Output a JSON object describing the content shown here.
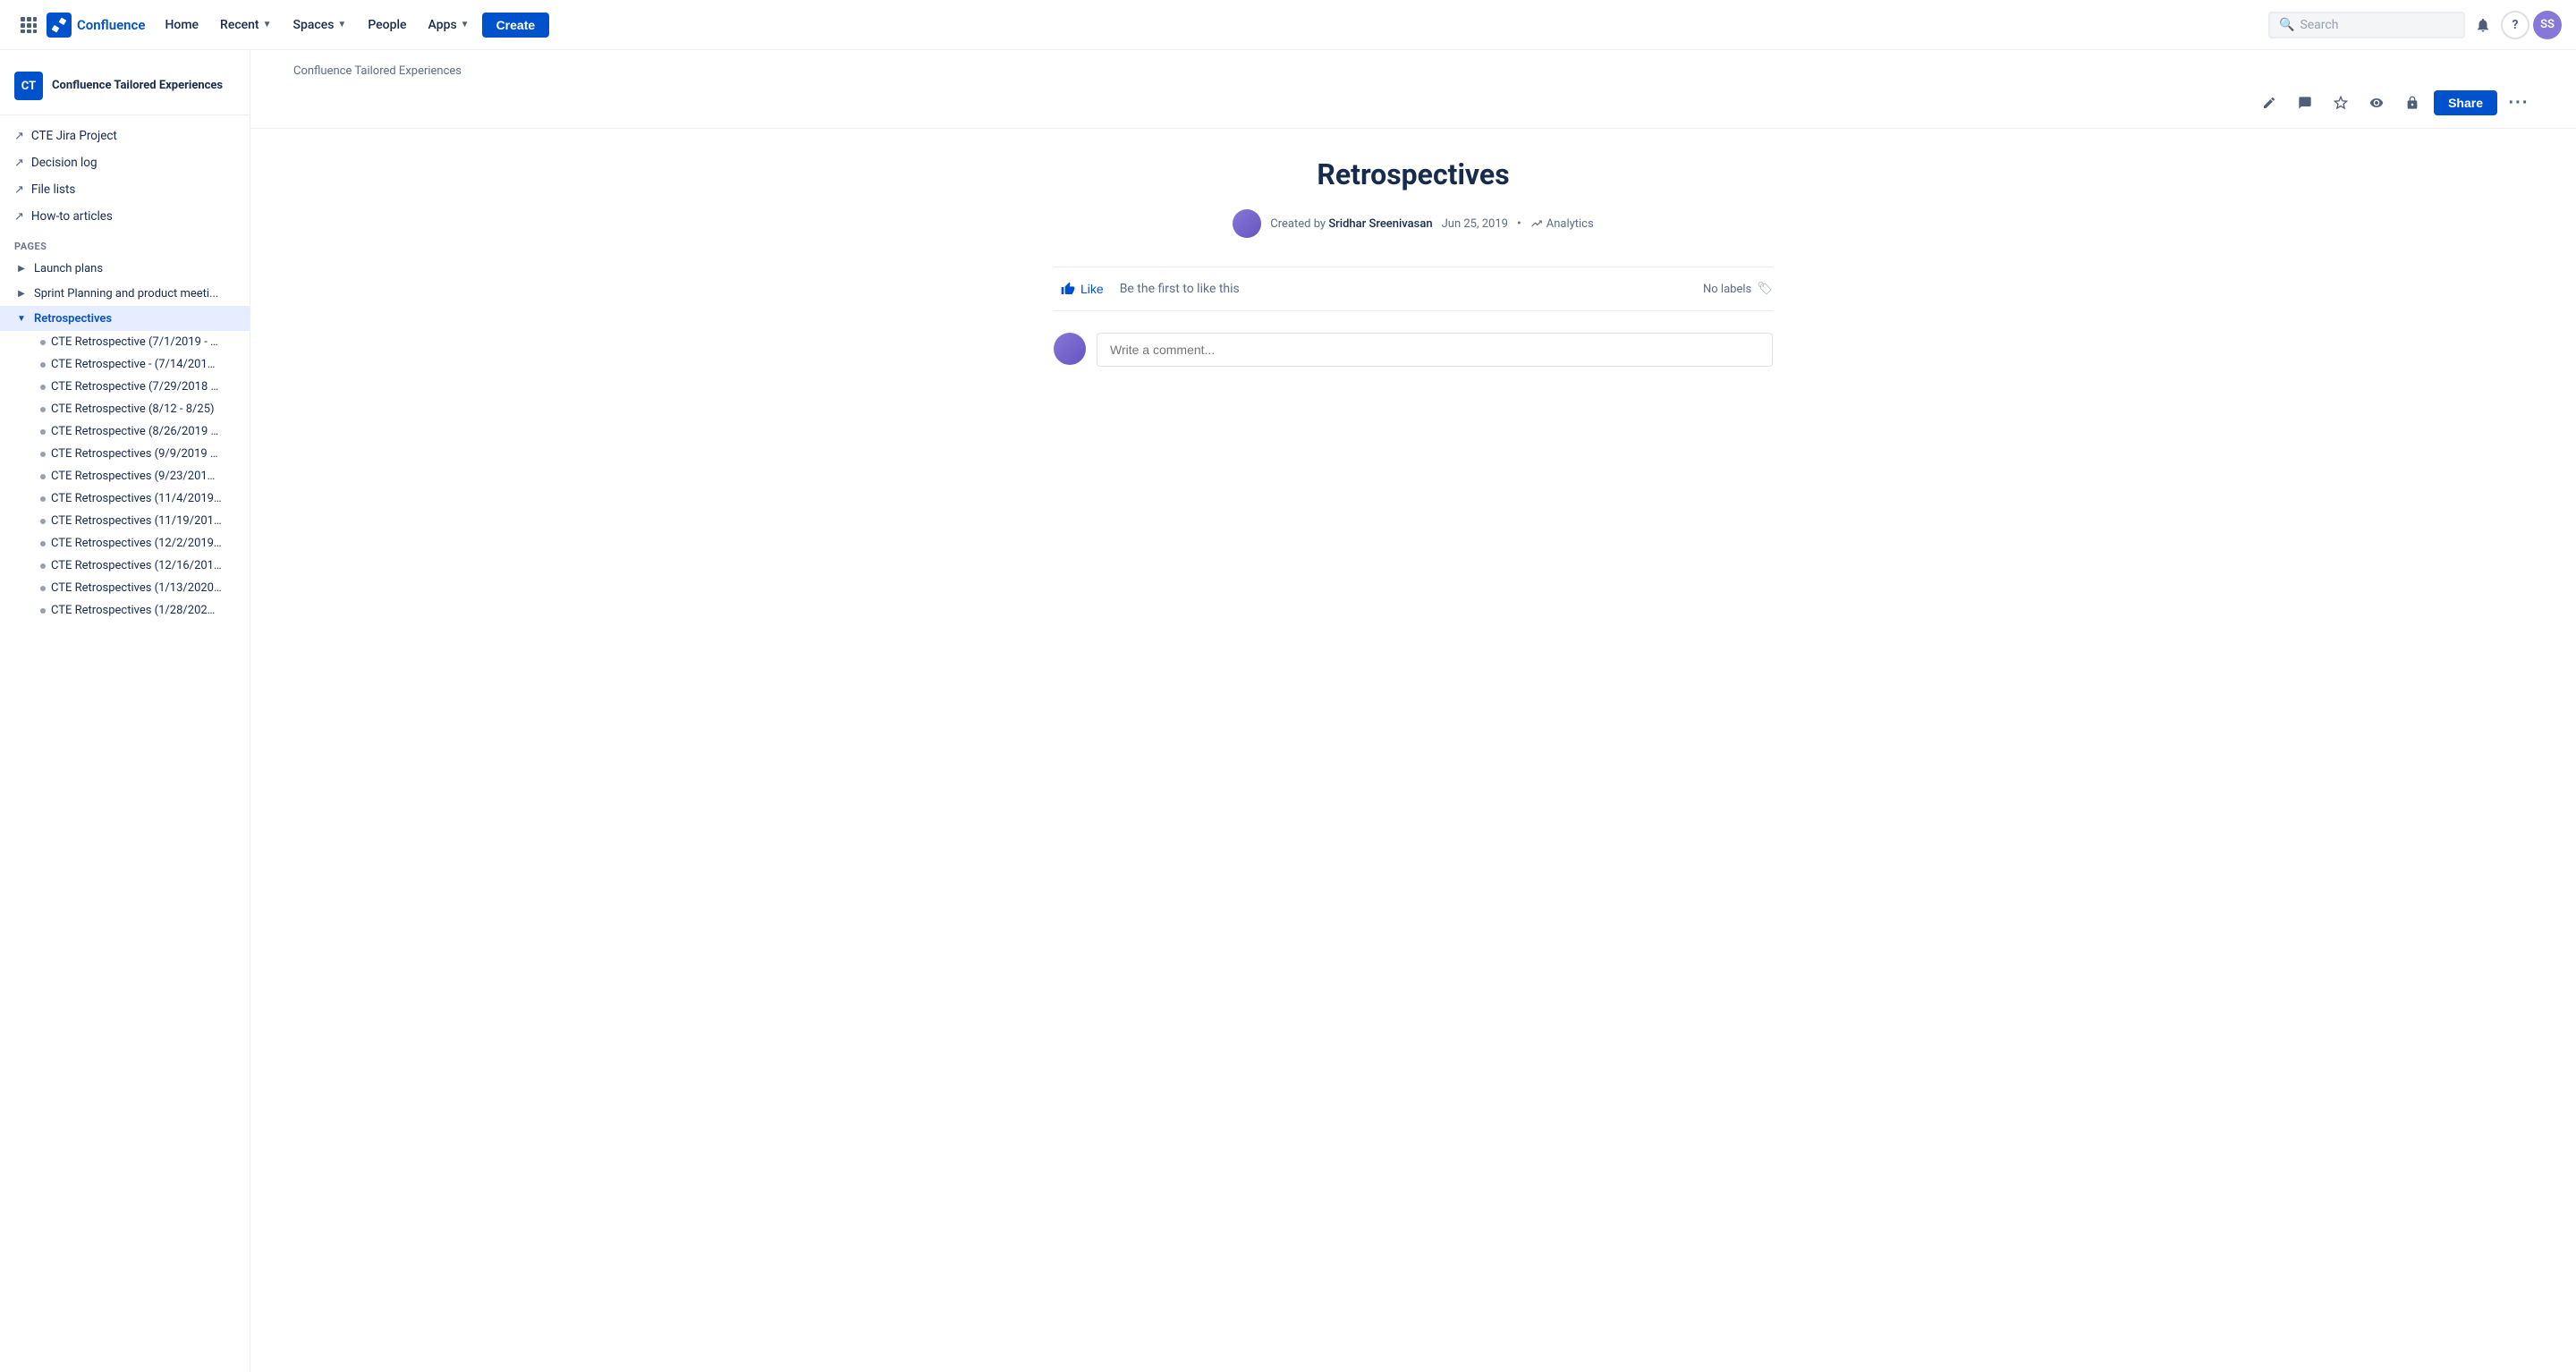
{
  "nav": {
    "logo_text": "Confluence",
    "home_label": "Home",
    "recent_label": "Recent",
    "spaces_label": "Spaces",
    "people_label": "People",
    "apps_label": "Apps",
    "create_label": "Create",
    "search_placeholder": "Search",
    "grid_icon": "⊞",
    "bell_icon": "🔔",
    "help_icon": "?",
    "avatar_initials": "SS"
  },
  "sidebar": {
    "space_name": "Confluence Tailored Experiences",
    "space_initials": "CT",
    "nav_items": [
      {
        "label": "CTE Jira Project",
        "icon": "↗"
      },
      {
        "label": "Decision log",
        "icon": "↗"
      },
      {
        "label": "File lists",
        "icon": "↗"
      },
      {
        "label": "How-to articles",
        "icon": "↗"
      }
    ],
    "pages_section_label": "PAGES",
    "tree_items": [
      {
        "label": "Launch plans",
        "expanded": false,
        "active": false,
        "indent": 0
      },
      {
        "label": "Sprint Planning and product meeti...",
        "expanded": false,
        "active": false,
        "indent": 0
      },
      {
        "label": "Retrospectives",
        "expanded": true,
        "active": true,
        "indent": 0
      }
    ],
    "child_items": [
      "CTE Retrospective (7/1/2019 - …",
      "CTE Retrospective - (7/14/201…",
      "CTE Retrospective (7/29/2018 …",
      "CTE Retrospective (8/12 - 8/25)",
      "CTE Retrospective (8/26/2019 …",
      "CTE Retrospectives (9/9/2019 …",
      "CTE Retrospectives (9/23/201…",
      "CTE Retrospectives (11/4/2019…",
      "CTE Retrospectives (11/19/201…",
      "CTE Retrospectives (12/2/2019…",
      "CTE Retrospectives (12/16/201…",
      "CTE Retrospectives (1/13/2020…",
      "CTE Retrospectives (1/28/202…"
    ]
  },
  "page": {
    "breadcrumb": "Confluence Tailored Experiences",
    "title": "Retrospectives",
    "created_by_label": "Created by",
    "author": "Sridhar Sreenivasan",
    "date": "Jun 25, 2019",
    "analytics_label": "Analytics",
    "like_label": "Like",
    "like_description": "Be the first to like this",
    "no_labels": "No labels",
    "comment_placeholder": "Write a comment...",
    "share_label": "Share"
  },
  "toolbar": {
    "edit_icon": "✏",
    "comment_icon": "💬",
    "star_icon": "☆",
    "watch_icon": "👁",
    "restrict_icon": "🔒",
    "more_icon": "•••"
  }
}
